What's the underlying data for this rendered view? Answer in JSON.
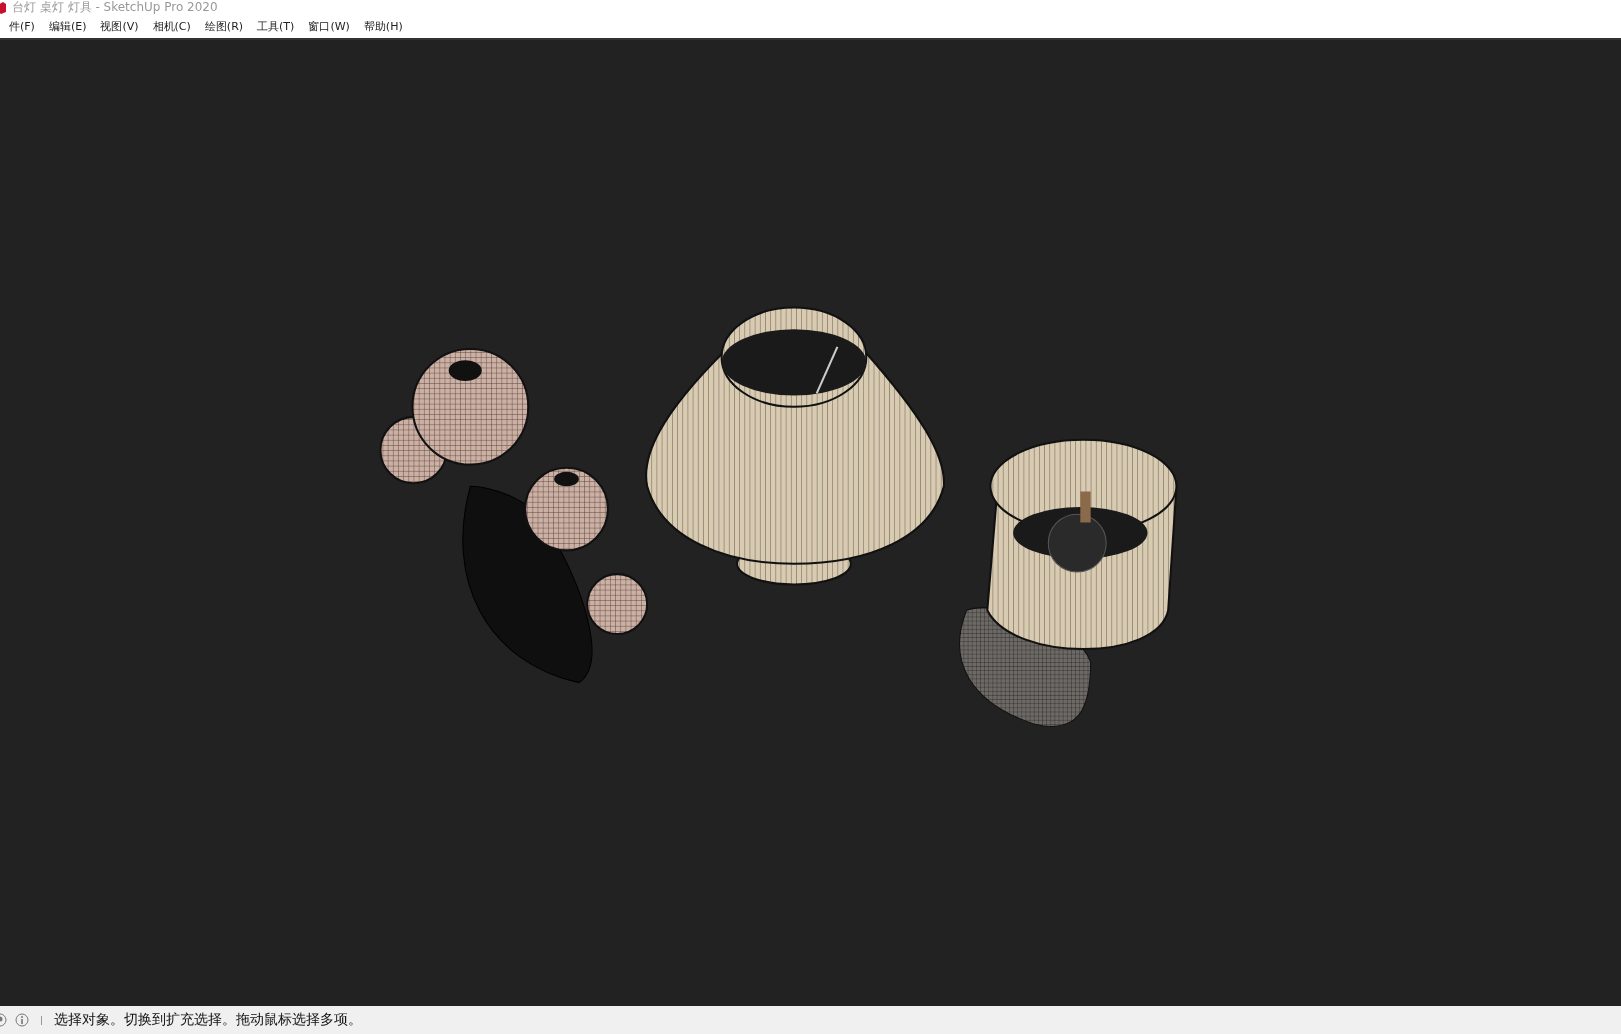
{
  "window": {
    "title": "台灯 桌灯 灯具 - SketchUp Pro 2020"
  },
  "menu": [
    "件(F)",
    "编辑(E)",
    "视图(V)",
    "相机(C)",
    "绘图(R)",
    "工具(T)",
    "窗口(W)",
    "帮助(H)"
  ],
  "status_bar": {
    "message": "选择对象。切换到扩充选择。拖动鼠标选择多项。"
  }
}
